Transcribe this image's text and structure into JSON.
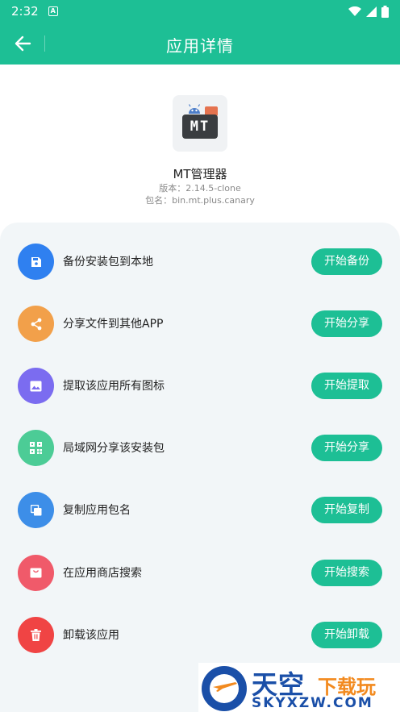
{
  "status_bar": {
    "time": "2:32",
    "notification_badge": "A",
    "icons": [
      "wifi-icon",
      "signal-icon",
      "battery-icon"
    ]
  },
  "app_bar": {
    "title": "应用详情",
    "back_icon": "arrow-left-icon"
  },
  "app": {
    "name": "MT管理器",
    "icon_text": "MT",
    "version": "版本：2.14.5-clone",
    "package": "包名：bin.mt.plus.canary"
  },
  "actions": [
    {
      "label": "备份安装包到本地",
      "button": "开始备份",
      "icon": "save-icon",
      "color": "#2f80f0"
    },
    {
      "label": "分享文件到其他APP",
      "button": "开始分享",
      "icon": "share-icon",
      "color": "#f2a04a"
    },
    {
      "label": "提取该应用所有图标",
      "button": "开始提取",
      "icon": "image-icon",
      "color": "#7b6cf0"
    },
    {
      "label": "局域网分享该安装包",
      "button": "开始分享",
      "icon": "qrcode-icon",
      "color": "#4ccc96"
    },
    {
      "label": "复制应用包名",
      "button": "开始复制",
      "icon": "copy-icon",
      "color": "#3d8ee8"
    },
    {
      "label": "在应用商店搜索",
      "button": "开始搜索",
      "icon": "store-icon",
      "color": "#f05a6a"
    },
    {
      "label": "卸载该应用",
      "button": "开始卸载",
      "icon": "trash-icon",
      "color": "#f04444"
    }
  ],
  "watermark": {
    "brand": "天空",
    "brand_suffix": "下载玩",
    "domain": "SKYXZW.COM"
  },
  "colors": {
    "accent": "#1dbf95",
    "card_background": "#f2f6f8"
  }
}
